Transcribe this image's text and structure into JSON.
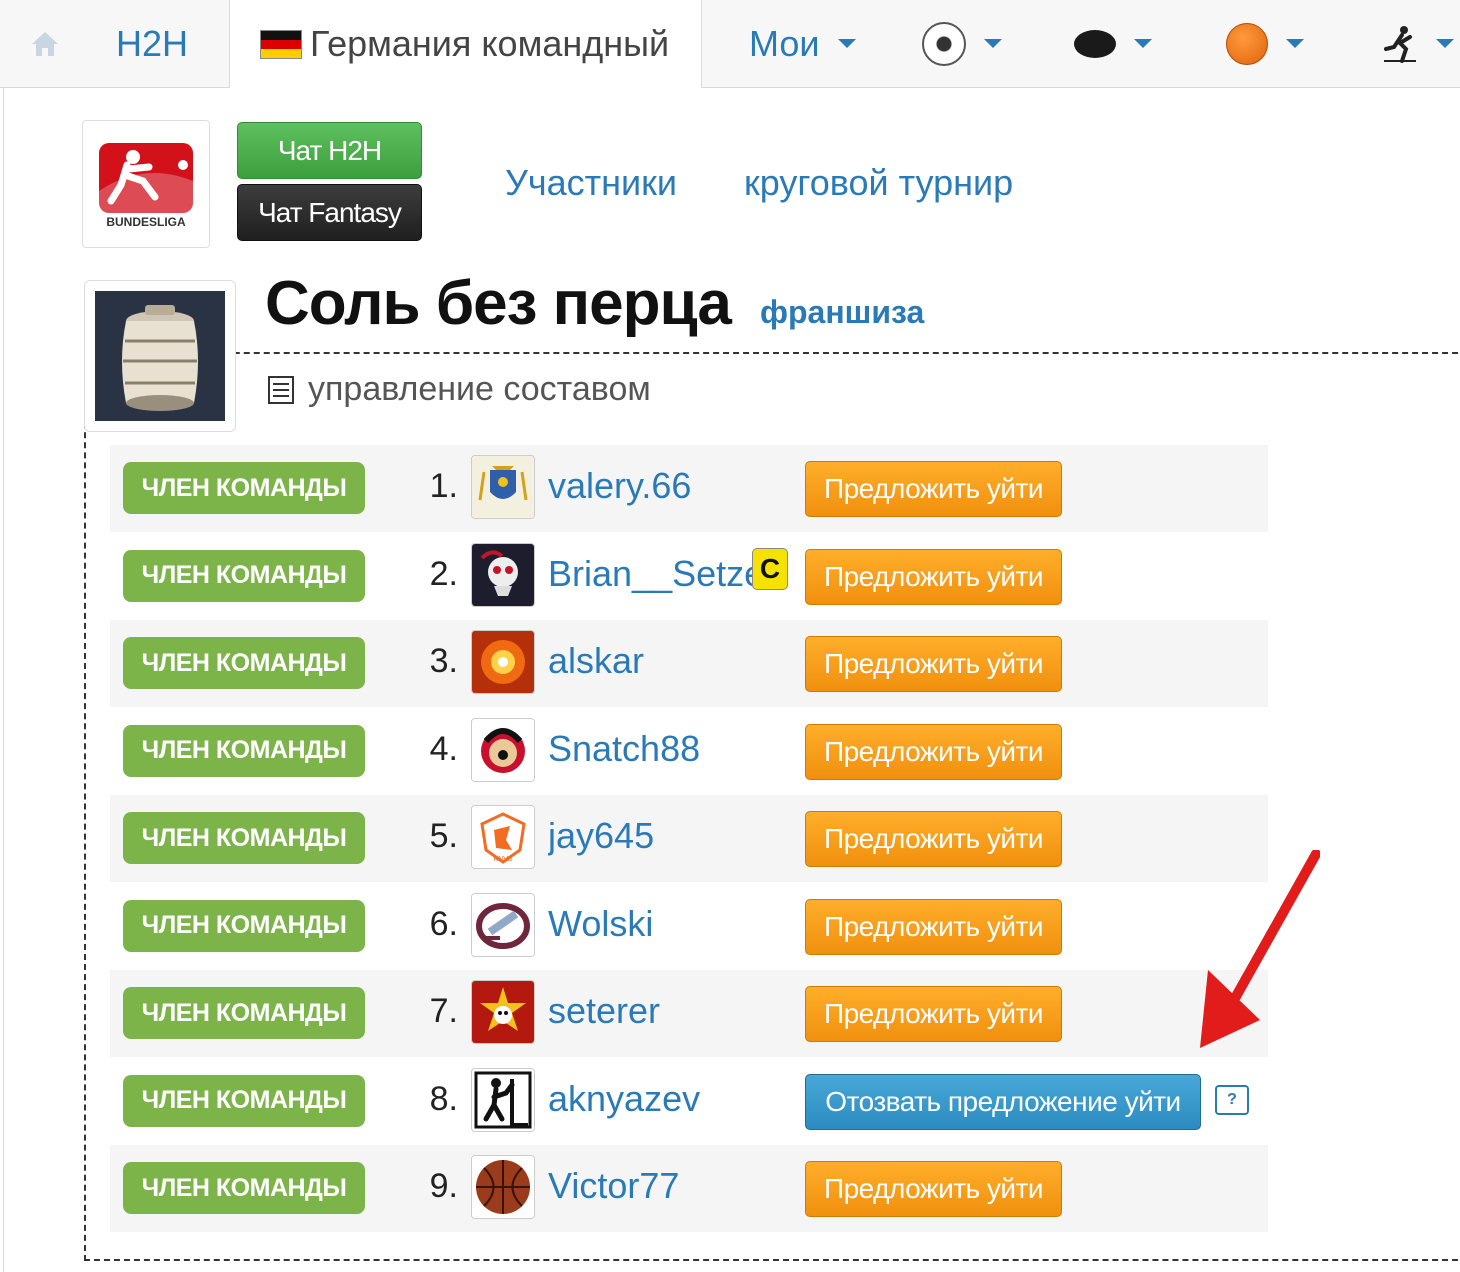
{
  "nav": {
    "h2h": "H2H",
    "league": "Германия командный",
    "mine": "Мои",
    "icons": [
      "home-icon",
      "germany-flag-icon",
      "soccer-ball-icon",
      "hockey-puck-icon",
      "basketball-icon",
      "running-man-icon"
    ]
  },
  "header": {
    "chat_h2h": "Чат H2H",
    "chat_fantasy": "Чат Fantasy",
    "participants": "Участники",
    "round_robin": "круговой турнир",
    "logo_text": "BUNDESLIGA"
  },
  "team": {
    "name": "Соль без перца",
    "franchise": "франшиза",
    "manage": "управление составом"
  },
  "roster": {
    "badge": "ЧЛЕН КОМАНДЫ",
    "offer_leave": "Предложить уйти",
    "revoke_offer": "Отозвать предложение уйти",
    "help": "?",
    "captain_mark": "C",
    "members": [
      {
        "num": "1.",
        "name": "valery.66",
        "avatar": "coat-of-arms-avatar"
      },
      {
        "num": "2.",
        "name": "Brian__Setzer",
        "avatar": "skull-avatar"
      },
      {
        "num": "3.",
        "name": "alskar",
        "avatar": "explosion-avatar"
      },
      {
        "num": "4.",
        "name": "Snatch88",
        "avatar": "senators-logo-avatar"
      },
      {
        "num": "5.",
        "name": "jay645",
        "avatar": "knvb-lion-avatar"
      },
      {
        "num": "6.",
        "name": "Wolski",
        "avatar": "avalanche-logo-avatar"
      },
      {
        "num": "7.",
        "name": "seterer",
        "avatar": "cska-logo-avatar"
      },
      {
        "num": "8.",
        "name": "aknyazev",
        "avatar": "climber-avatar"
      },
      {
        "num": "9.",
        "name": "Victor77",
        "avatar": "basketball-avatar"
      }
    ]
  },
  "colors": {
    "link": "#2a7ab8",
    "badge_green": "#7db44a",
    "offer_orange": "#f39c12",
    "revoke_blue": "#2c8cc0",
    "arrow_red": "#e21b1b"
  }
}
